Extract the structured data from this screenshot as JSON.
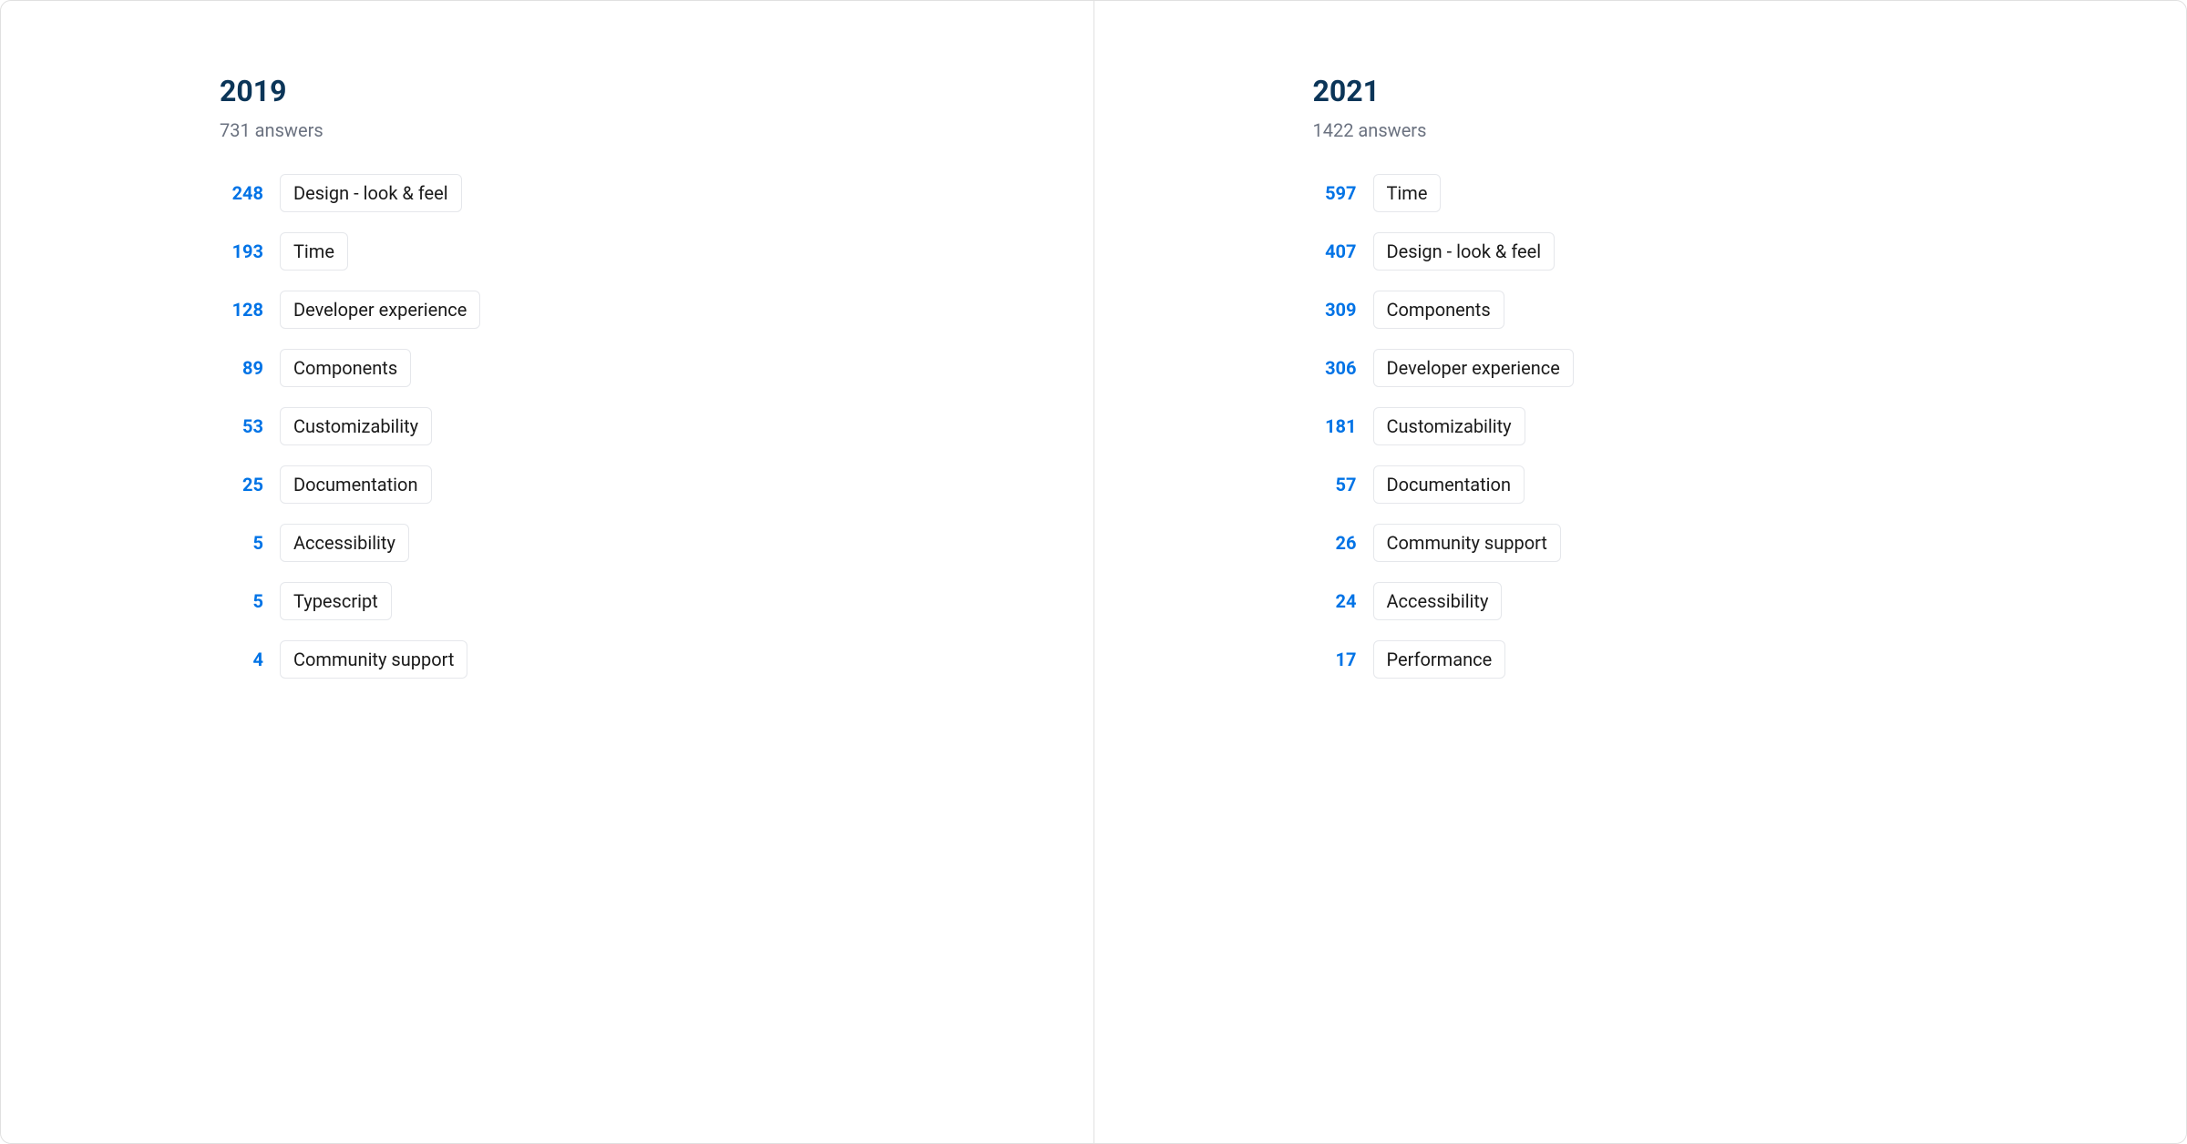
{
  "chart_data": [
    {
      "type": "bar",
      "title": "2019",
      "subtitle": "731 answers",
      "categories": [
        "Design - look & feel",
        "Time",
        "Developer experience",
        "Components",
        "Customizability",
        "Documentation",
        "Accessibility",
        "Typescript",
        "Community support"
      ],
      "values": [
        248,
        193,
        128,
        89,
        53,
        25,
        5,
        5,
        4
      ]
    },
    {
      "type": "bar",
      "title": "2021",
      "subtitle": "1422 answers",
      "categories": [
        "Time",
        "Design - look & feel",
        "Components",
        "Developer experience",
        "Customizability",
        "Documentation",
        "Community support",
        "Accessibility",
        "Performance"
      ],
      "values": [
        597,
        407,
        309,
        306,
        181,
        57,
        26,
        24,
        17
      ]
    }
  ],
  "panels": {
    "left": {
      "title": "2019",
      "subtitle": "731 answers",
      "items": [
        {
          "count": "248",
          "label": "Design - look & feel"
        },
        {
          "count": "193",
          "label": "Time"
        },
        {
          "count": "128",
          "label": "Developer experience"
        },
        {
          "count": "89",
          "label": "Components"
        },
        {
          "count": "53",
          "label": "Customizability"
        },
        {
          "count": "25",
          "label": "Documentation"
        },
        {
          "count": "5",
          "label": "Accessibility"
        },
        {
          "count": "5",
          "label": "Typescript"
        },
        {
          "count": "4",
          "label": "Community support"
        }
      ]
    },
    "right": {
      "title": "2021",
      "subtitle": "1422 answers",
      "items": [
        {
          "count": "597",
          "label": "Time"
        },
        {
          "count": "407",
          "label": "Design - look & feel"
        },
        {
          "count": "309",
          "label": "Components"
        },
        {
          "count": "306",
          "label": "Developer experience"
        },
        {
          "count": "181",
          "label": "Customizability"
        },
        {
          "count": "57",
          "label": "Documentation"
        },
        {
          "count": "26",
          "label": "Community support"
        },
        {
          "count": "24",
          "label": "Accessibility"
        },
        {
          "count": "17",
          "label": "Performance"
        }
      ]
    }
  }
}
